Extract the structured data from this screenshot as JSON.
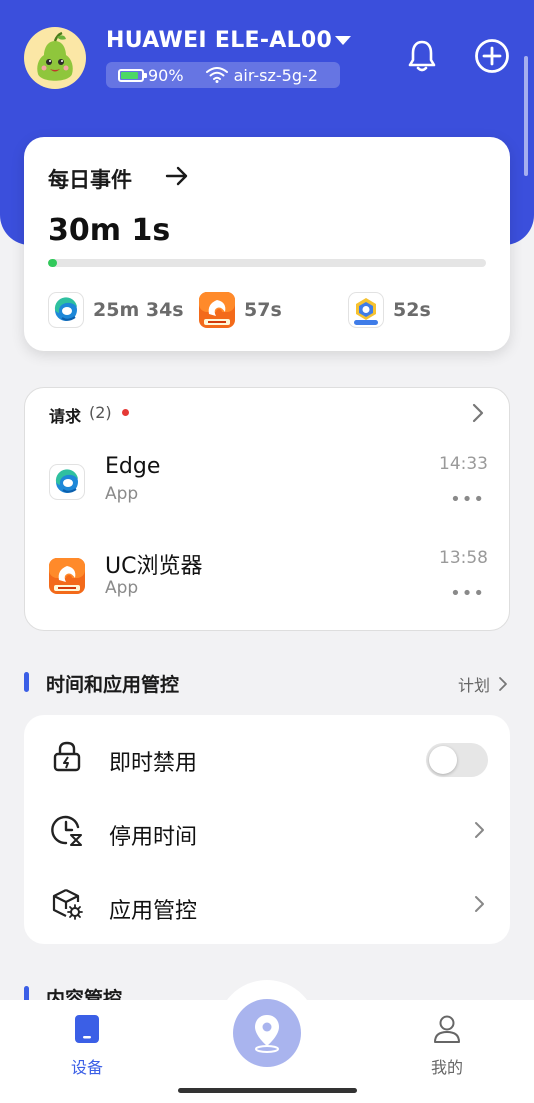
{
  "header": {
    "device_name": "HUAWEI ELE-AL00",
    "battery": "90%",
    "wifi": "air-sz-5g-2",
    "battery_color": "#4cd964"
  },
  "daily": {
    "title": "每日事件",
    "total": "30m 1s",
    "progress_fraction": 0.02,
    "apps": [
      {
        "icon": "edge-app-icon",
        "time": "25m 34s"
      },
      {
        "icon": "uc-browser-app-icon",
        "time": "57s"
      },
      {
        "icon": "kids-app-icon",
        "time": "52s"
      }
    ]
  },
  "requests": {
    "title": "请求",
    "count": "(2)",
    "items": [
      {
        "name": "Edge",
        "type": "App",
        "time": "14:33",
        "more": "•••"
      },
      {
        "name": "UC浏览器",
        "type": "App",
        "time": "13:58",
        "more": "•••"
      }
    ]
  },
  "time_control": {
    "title": "时间和应用管控",
    "plan": "计划",
    "rows": [
      {
        "label": "即时禁用",
        "icon": "lock-icon",
        "toggle": false
      },
      {
        "label": "停用时间",
        "icon": "clock-hourglass-icon"
      },
      {
        "label": "应用管控",
        "icon": "box-gear-icon"
      }
    ]
  },
  "content_control": {
    "title": "内容管控"
  },
  "tabbar": {
    "devices": "设备",
    "mine": "我的",
    "accent": "#3b5fe6"
  }
}
